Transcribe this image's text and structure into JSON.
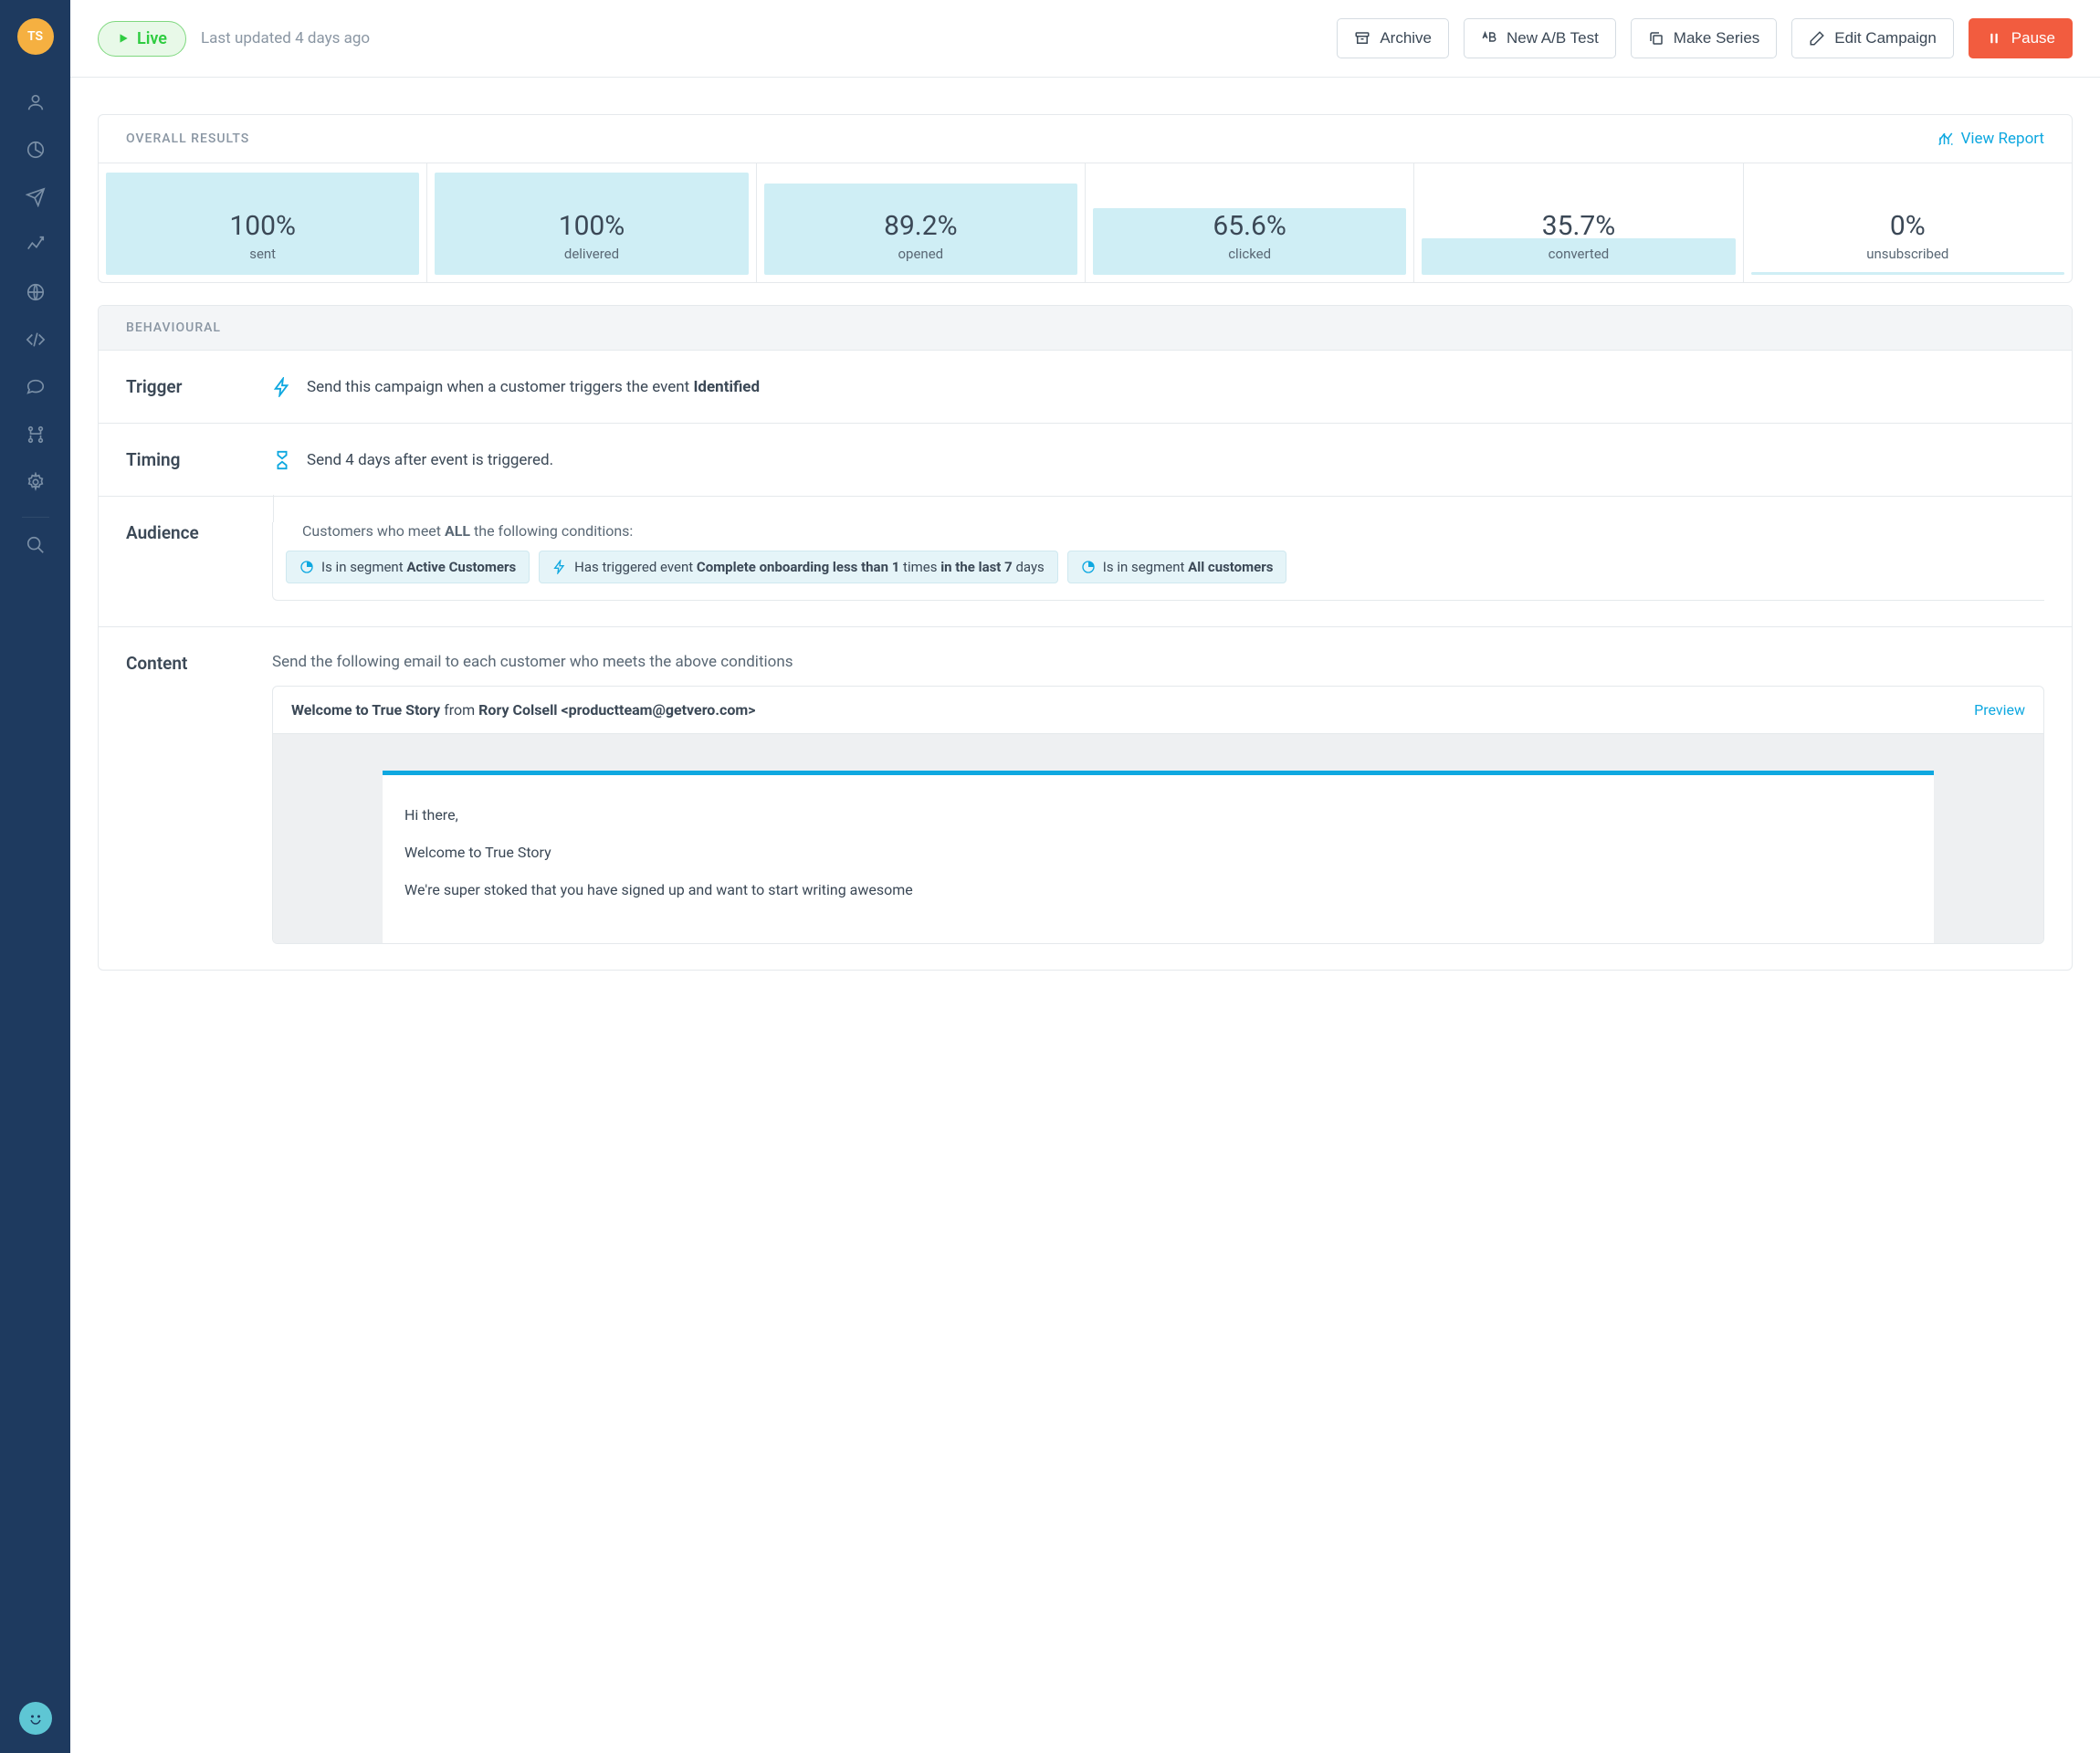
{
  "avatar": {
    "initials": "TS"
  },
  "topbar": {
    "status": "Live",
    "last_updated": "Last updated 4 days ago",
    "archive": "Archive",
    "ab_test": "New A/B Test",
    "make_series": "Make Series",
    "edit_campaign": "Edit Campaign",
    "pause": "Pause"
  },
  "results": {
    "title": "OVERALL RESULTS",
    "view_report": "View Report",
    "metrics": [
      {
        "value": "100%",
        "label": "sent",
        "fill": 100
      },
      {
        "value": "100%",
        "label": "delivered",
        "fill": 100
      },
      {
        "value": "89.2%",
        "label": "opened",
        "fill": 89.2
      },
      {
        "value": "65.6%",
        "label": "clicked",
        "fill": 65.6
      },
      {
        "value": "35.7%",
        "label": "converted",
        "fill": 35.7
      },
      {
        "value": "0%",
        "label": "unsubscribed",
        "fill": 0
      }
    ]
  },
  "behavioural": {
    "title": "BEHAVIOURAL",
    "trigger": {
      "label": "Trigger",
      "text_pre": "Send this campaign when a customer triggers the event ",
      "event": "Identified"
    },
    "timing": {
      "label": "Timing",
      "text": "Send 4 days after event is triggered."
    },
    "audience": {
      "label": "Audience",
      "intro_pre": "Customers who meet ",
      "intro_bold": "ALL",
      "intro_post": " the following conditions:",
      "chips": [
        {
          "type": "segment",
          "pre": "Is in segment ",
          "bold": "Active Customers"
        },
        {
          "type": "event",
          "pre": "Has triggered event ",
          "bold1": "Complete onboarding less than 1",
          "mid": " times ",
          "bold2": "in the last 7",
          "post": " days"
        },
        {
          "type": "segment",
          "pre": "Is in segment ",
          "bold": "All customers"
        }
      ]
    },
    "content": {
      "label": "Content",
      "intro": "Send the following email to each customer who meets the above conditions",
      "subject": "Welcome to True Story",
      "from_label": " from ",
      "from": "Rory Colsell <productteam@getvero.com>",
      "preview": "Preview",
      "body": {
        "greeting": "Hi there,",
        "line1": "Welcome to True Story",
        "line2": "We're super stoked that you have signed up and want to start writing awesome"
      }
    }
  }
}
